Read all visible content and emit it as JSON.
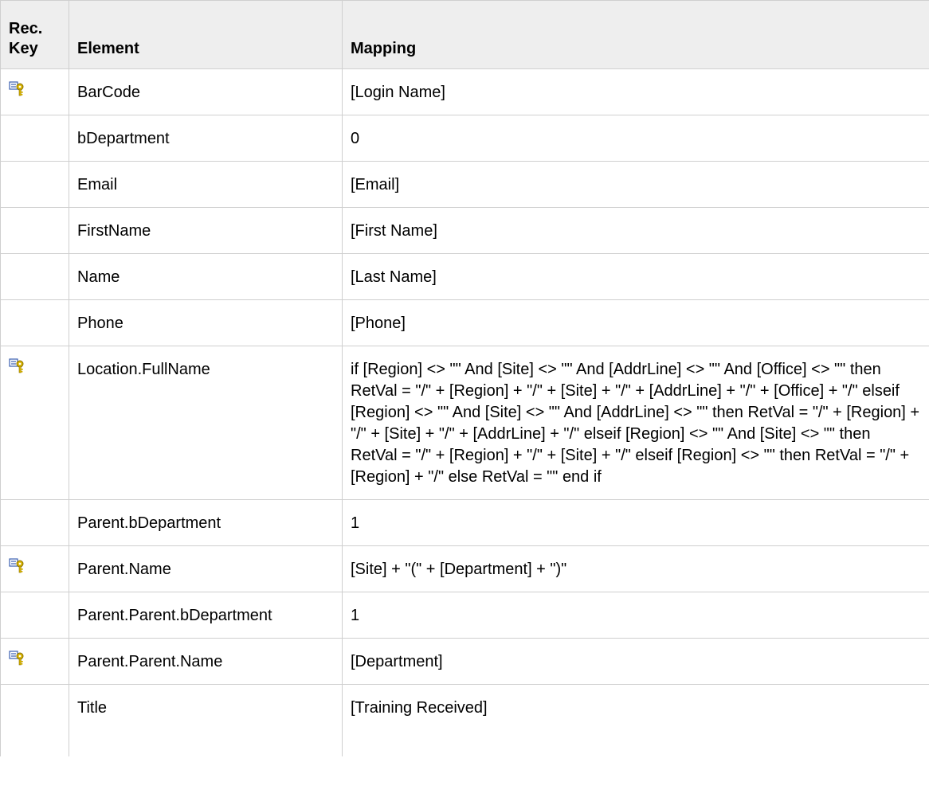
{
  "table": {
    "headers": {
      "key": "Rec.\nKey",
      "element": "Element",
      "mapping": "Mapping"
    },
    "rows": [
      {
        "key": true,
        "element": "BarCode",
        "mapping": "[Login Name]"
      },
      {
        "key": false,
        "element": "bDepartment",
        "mapping": "0"
      },
      {
        "key": false,
        "element": "Email",
        "mapping": "[Email]"
      },
      {
        "key": false,
        "element": "FirstName",
        "mapping": "[First Name]"
      },
      {
        "key": false,
        "element": "Name",
        "mapping": "[Last Name]"
      },
      {
        "key": false,
        "element": "Phone",
        "mapping": "[Phone]"
      },
      {
        "key": true,
        "element": "Location.FullName",
        "mapping": "if [Region] <> \"\" And [Site] <> \"\" And [AddrLine] <> \"\" And [Office] <> \"\" then RetVal = \"/\" + [Region] + \"/\" + [Site] + \"/\" + [AddrLine] + \"/\" + [Office] + \"/\" elseif [Region] <> \"\" And [Site] <> \"\" And [AddrLine] <> \"\" then RetVal = \"/\" + [Region] + \"/\" + [Site] + \"/\" + [AddrLine] + \"/\" elseif [Region] <> \"\" And [Site] <> \"\" then RetVal = \"/\" + [Region] + \"/\" + [Site] + \"/\" elseif [Region] <> \"\" then RetVal = \"/\" + [Region] + \"/\" else RetVal = \"\" end if"
      },
      {
        "key": false,
        "element": "Parent.bDepartment",
        "mapping": "1"
      },
      {
        "key": true,
        "element": "Parent.Name",
        "mapping": "[Site] + \"(\" + [Department] + \")\""
      },
      {
        "key": false,
        "element": "Parent.Parent.bDepartment",
        "mapping": "1"
      },
      {
        "key": true,
        "element": "Parent.Parent.Name",
        "mapping": "[Department]"
      },
      {
        "key": false,
        "element": "Title",
        "mapping": "[Training Received]"
      }
    ]
  },
  "icons": {
    "reconciliation_key": "reconciliation-key-icon"
  },
  "colors": {
    "header_bg": "#eeeeee",
    "border": "#cfcfcf",
    "icon_gold": "#d8b400",
    "icon_blue": "#3a5fb0"
  }
}
